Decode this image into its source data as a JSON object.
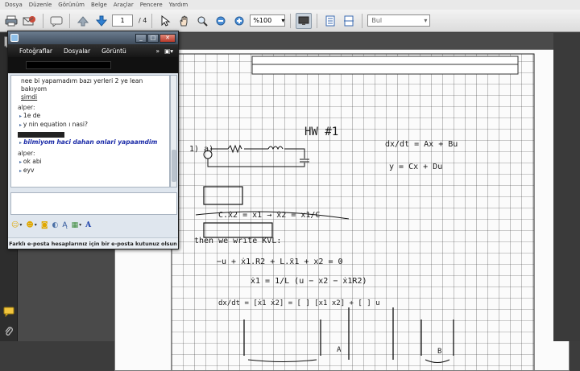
{
  "menu": [
    "Dosya",
    "Düzenle",
    "Görünüm",
    "Belge",
    "Araçlar",
    "Pencere",
    "Yardım"
  ],
  "toolbar": {
    "page_current": "1",
    "page_total": "/ 4",
    "zoom": "%100",
    "find_placeholder": "Bul"
  },
  "chat": {
    "menu_items": [
      "Fotoğraflar",
      "Dosyalar",
      "Görüntü"
    ],
    "menu_more": "»",
    "messages": {
      "l1": "nee bi yapamadım bazı yerleri 2 ye lean",
      "l2": "bakıyom",
      "l3": "şimdi",
      "s1": "alper:",
      "b1": "1e de",
      "b2": "y nin equation ı nasi?",
      "mine": "bilmiyom haci dahan onlari yapaamdim",
      "s2": "alper:",
      "b3": "ok abi",
      "b4": "eyv"
    },
    "footer": "Farklı e-posta hesaplarınız için bir e-posta kutunuz olsun",
    "tool_font": "A"
  },
  "document": {
    "title": "HW #1",
    "line1_label": "1) a)",
    "eq1": "dx/dt = Ax + Bu",
    "eq2": "y = Cx + Du",
    "eq3": "C.ẋ2 = x1 → ẋ2 = x1/C",
    "eq4": "then we write KVL:",
    "eq5": "−u + ẋ1.R2 + L.ẍ1 + x2 = 0",
    "eq6": "ẋ1 = 1/L (u − x2 − ẋ1R2)",
    "eq7": "dx/dt = [ẋ1 ẋ2] = [ ] [x1 x2] + [ ] u",
    "label_a": "A",
    "label_b": "B"
  }
}
